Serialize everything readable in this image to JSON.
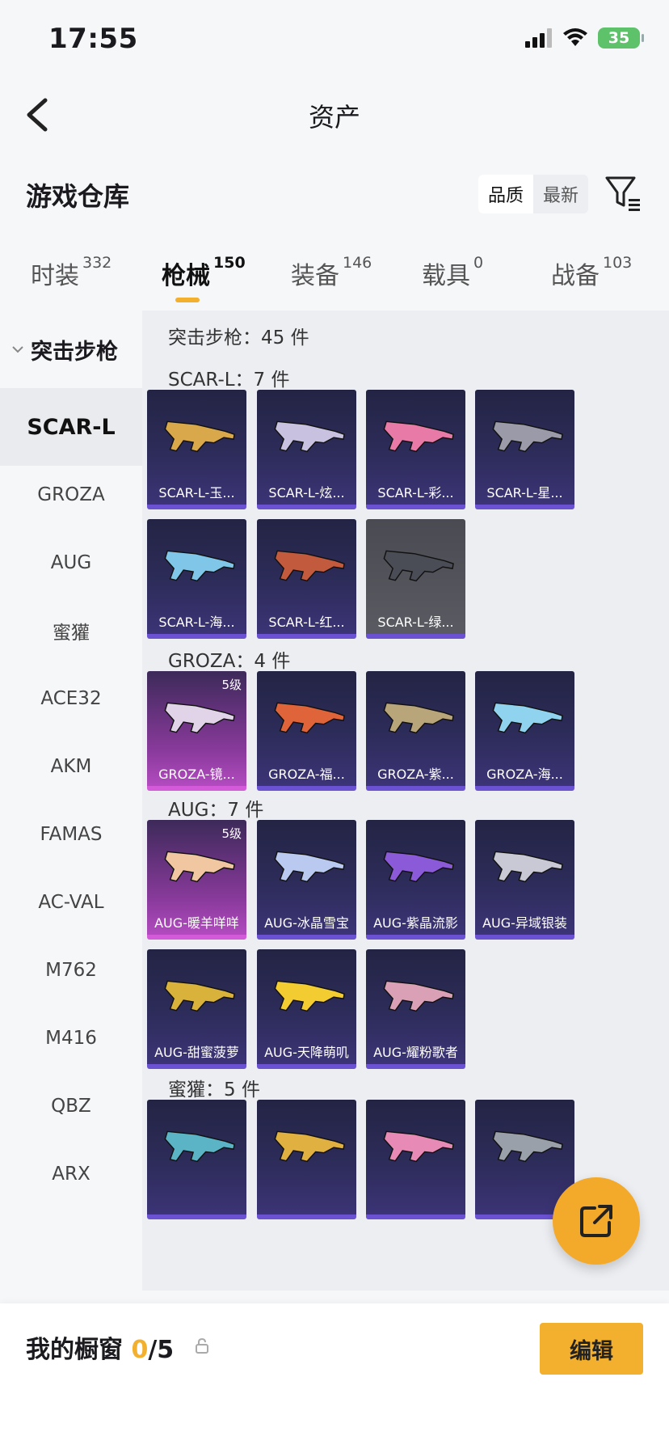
{
  "status": {
    "time": "17:55",
    "battery": "35"
  },
  "nav": {
    "title": "资产"
  },
  "warehouse": {
    "title": "游戏仓库",
    "sort_quality": "品质",
    "sort_newest": "最新"
  },
  "tabs": [
    {
      "label": "时装",
      "count": "332"
    },
    {
      "label": "枪械",
      "count": "150"
    },
    {
      "label": "装备",
      "count": "146"
    },
    {
      "label": "载具",
      "count": "0"
    },
    {
      "label": "战备",
      "count": "103"
    }
  ],
  "sidebar": {
    "category": "突击步枪",
    "items": [
      "SCAR-L",
      "GROZA",
      "AUG",
      "蜜獾",
      "ACE32",
      "AKM",
      "FAMAS",
      "AC-VAL",
      "M762",
      "M416",
      "QBZ",
      "ARX"
    ]
  },
  "main": {
    "total": "突击步枪：45 件",
    "sections": [
      {
        "title": "SCAR-L：7 件",
        "items": [
          {
            "label": "SCAR-L-玉...",
            "color": "#d9a84a"
          },
          {
            "label": "SCAR-L-炫...",
            "color": "#c8c2e0"
          },
          {
            "label": "SCAR-L-彩...",
            "color": "#e87aa8"
          },
          {
            "label": "SCAR-L-星...",
            "color": "#9a9aa8"
          },
          {
            "label": "SCAR-L-海...",
            "color": "#7fc6e8"
          },
          {
            "label": "SCAR-L-红...",
            "color": "#c25a3e"
          },
          {
            "label": "SCAR-L-绿...",
            "color": "#4a4d55"
          }
        ]
      },
      {
        "title": "GROZA：4 件",
        "items": [
          {
            "label": "GROZA-镜...",
            "color": "#e2d4e8",
            "badge": "5级"
          },
          {
            "label": "GROZA-福...",
            "color": "#e0643a"
          },
          {
            "label": "GROZA-紫...",
            "color": "#b9a57a"
          },
          {
            "label": "GROZA-海...",
            "color": "#8fd3ef"
          }
        ]
      },
      {
        "title": "AUG：7 件",
        "items": [
          {
            "label": "AUG-暖羊咩咩",
            "color": "#f0c7a0",
            "badge": "5级"
          },
          {
            "label": "AUG-冰晶雪宝",
            "color": "#b9c9ef"
          },
          {
            "label": "AUG-紫晶流影",
            "color": "#8a5ad8"
          },
          {
            "label": "AUG-异域银装",
            "color": "#c9c9d6"
          },
          {
            "label": "AUG-甜蜜菠萝",
            "color": "#d8b23a"
          },
          {
            "label": "AUG-天降萌叽",
            "color": "#f2cc30"
          },
          {
            "label": "AUG-耀粉歌者",
            "color": "#d9a0b6"
          }
        ]
      },
      {
        "title": "蜜獾：5 件",
        "items": [
          {
            "label": "",
            "color": "#5ab4c6"
          },
          {
            "label": "",
            "color": "#e0b040"
          },
          {
            "label": "",
            "color": "#e88ab6"
          },
          {
            "label": "",
            "color": "#9aa0aa"
          }
        ]
      }
    ]
  },
  "bottom": {
    "showcase_label": "我的橱窗",
    "showcase_count": "0",
    "showcase_total": "/5",
    "edit": "编辑"
  },
  "colors": {
    "accent": "#f2b02e",
    "card_purple": "#6a52d3"
  }
}
